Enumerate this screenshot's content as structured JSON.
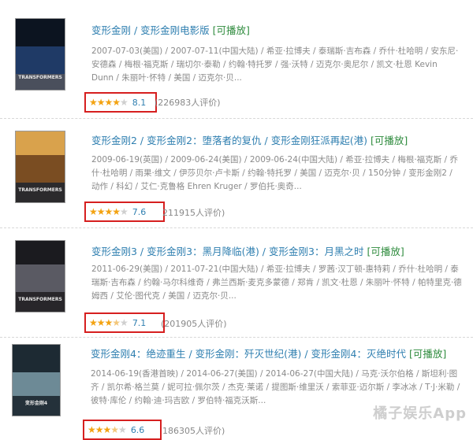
{
  "movies": [
    {
      "title": "变形金刚",
      "alt_titles": [
        " / 变形金刚电影版"
      ],
      "playable": "[可播放]",
      "meta": "2007-07-03(美国) / 2007-07-11(中国大陆) / 希亚·拉博夫 / 泰瑞斯·吉布森 / 乔什·杜哈明 / 安东尼·安德森 / 梅根·福克斯 / 瑞切尔·泰勒 / 约翰·特托罗 / 强·沃特 / 迈克尔·奥尼尔 / 凯文·杜恩 Kevin Dunn / 朱丽叶·怀特 / 美国 / 迈克尔·贝...",
      "stars": {
        "full": 4,
        "half": 0,
        "empty": 1
      },
      "score": "8.1",
      "votes": "(226983人评价)",
      "poster_colors": [
        "#0c1420",
        "#1f3a66",
        "#4a4f5c"
      ],
      "poster_text": "TRANSFORMERS"
    },
    {
      "title": "变形金刚2",
      "alt_titles": [
        " / 变形金刚2：堕落者的复仇",
        " / 变形金刚狂派再起(港)"
      ],
      "playable": "[可播放]",
      "meta": "2009-06-19(英国) / 2009-06-24(美国) / 2009-06-24(中国大陆) / 希亚·拉博夫 / 梅根·福克斯 / 乔什·杜哈明 / 雨果·维文 / 伊莎贝尔·卢卡斯 / 约翰·特托罗 / 美国 / 迈克尔·贝 / 150分钟 / 变形金刚2 / 动作 / 科幻 / 艾仁·克鲁格 Ehren Kruger / 罗伯托·奥奇...",
      "stars": {
        "full": 4,
        "half": 0,
        "empty": 1
      },
      "score": "7.6",
      "votes": "211915人评价)",
      "poster_colors": [
        "#d9a24c",
        "#7a4d22",
        "#2b2a2c"
      ],
      "poster_text": "TRANSFORMERS"
    },
    {
      "title": "变形金刚3",
      "alt_titles": [
        " / 变形金刚3：黑月降临(港)",
        " / 变形金刚3：月黑之时"
      ],
      "playable": "[可播放]",
      "meta": "2011-06-29(美国) / 2011-07-21(中国大陆) / 希亚·拉博夫 / 罗茜·汉丁顿-惠特莉 / 乔什·杜哈明 / 泰瑞斯·吉布森 / 约翰·马尔科维奇 / 弗兰西斯·麦克多蒙德 / 郑肯 / 凯文·杜恩 / 朱丽叶·怀特 / 帕特里克·德姆西 / 艾伦·图代克 / 美国 / 迈克尔·贝...",
      "stars": {
        "full": 3,
        "half": 1,
        "empty": 1
      },
      "score": "7.1",
      "votes": "(201905人评价)",
      "poster_colors": [
        "#1b1b1f",
        "#5a5a63",
        "#28262a"
      ],
      "poster_text": "TRANSFORMERS"
    },
    {
      "title": "变形金刚4：绝迹重生",
      "alt_titles": [
        " / 变形金刚：歼灭世纪(港)",
        " / 变形金刚4：灭绝时代"
      ],
      "playable": "[可播放]",
      "meta": "2014-06-19(香港首映) / 2014-06-27(美国) / 2014-06-27(中国大陆) / 马克·沃尔伯格 / 斯坦利·图齐 / 凯尔希·格兰莫 / 妮可拉·佩尔茨 / 杰克·莱诺 / 提图斯·维里沃 / 索菲亚·迈尔斯 / 李冰冰 / T·J·米勒 / 彼特·库伦 / 约翰·迪·玛吉欧 / 罗伯特·福克沃斯...",
      "stars": {
        "full": 3,
        "half": 1,
        "empty": 1
      },
      "score": "6.6",
      "votes": "186305人评价)",
      "poster_colors": [
        "#1d2a33",
        "#6d8a96",
        "#24313a"
      ],
      "poster_text": "变形金刚4"
    }
  ],
  "watermark": "橘子娱乐App"
}
